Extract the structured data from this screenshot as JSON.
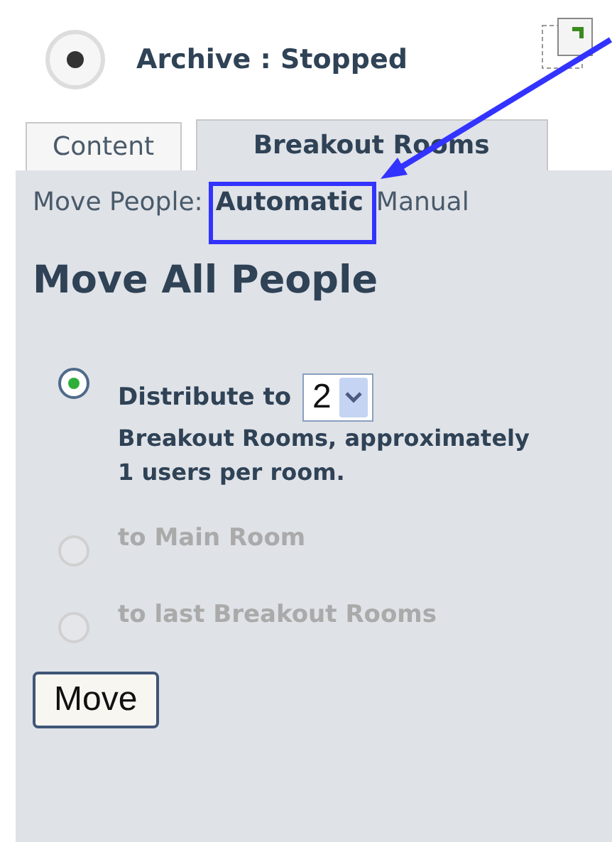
{
  "status": {
    "label": "Archive : Stopped",
    "recording": false
  },
  "tabs": [
    {
      "label": "Content",
      "selected": false
    },
    {
      "label": "Breakout Rooms",
      "selected": true
    }
  ],
  "move_people": {
    "label": "Move People:",
    "modes": [
      {
        "label": "Automatic",
        "selected": true,
        "highlighted": true
      },
      {
        "label": "Manual",
        "selected": false,
        "highlighted": false
      }
    ]
  },
  "heading": "Move All People",
  "options": [
    {
      "kind": "distribute",
      "selected": true,
      "disabled": false,
      "prefix": "Distribute to",
      "count": "2",
      "suffix": "Breakout Rooms, approximately 1 users per room."
    },
    {
      "kind": "plain",
      "selected": false,
      "disabled": true,
      "label": "to Main Room"
    },
    {
      "kind": "plain",
      "selected": false,
      "disabled": true,
      "label": "to last Breakout Rooms"
    }
  ],
  "button": "Move"
}
